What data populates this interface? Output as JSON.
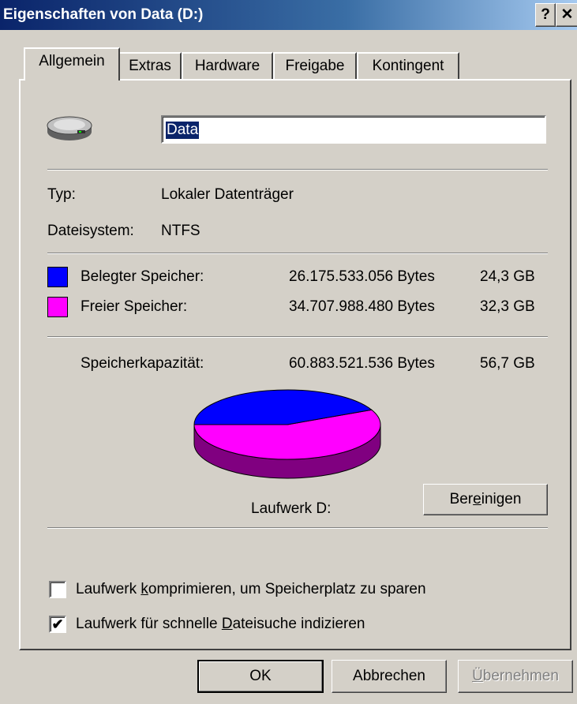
{
  "window": {
    "title": "Eigenschaften von Data (D:)",
    "help_label": "?",
    "close_label": "✕"
  },
  "tabs": [
    "Allgemein",
    "Extras",
    "Hardware",
    "Freigabe",
    "Kontingent"
  ],
  "active_tab": "Allgemein",
  "drive": {
    "icon": "hard-drive-icon",
    "name_value": "Data",
    "type_label": "Typ:",
    "type_value": "Lokaler Datenträger",
    "fs_label": "Dateisystem:",
    "fs_value": "NTFS"
  },
  "space": {
    "used": {
      "label": "Belegter Speicher:",
      "bytes": "26.175.533.056 Bytes",
      "size": "24,3 GB",
      "color": "#0000ff"
    },
    "free": {
      "label": "Freier Speicher:",
      "bytes": "34.707.988.480 Bytes",
      "size": "32,3 GB",
      "color": "#ff00ff"
    },
    "capacity": {
      "label": "Speicherkapazität:",
      "bytes": "60.883.521.536 Bytes",
      "size": "56,7 GB"
    }
  },
  "pie": {
    "used_fraction": 0.43,
    "used_color": "#0000ff",
    "free_color": "#ff00ff",
    "free_side_color": "#800080",
    "used_side_color": "#000080"
  },
  "drive_label": "Laufwerk D:",
  "cleanup": {
    "pre": "Ber",
    "ul": "e",
    "post": "inigen"
  },
  "options": {
    "compress": {
      "pre": "Laufwerk ",
      "ul": "k",
      "post": "omprimieren, um Speicherplatz zu sparen",
      "checked": false
    },
    "index": {
      "pre": "Laufwerk für schnelle ",
      "ul": "D",
      "post": "ateisuche indizieren",
      "checked": true
    }
  },
  "buttons": {
    "ok": "OK",
    "cancel": "Abbrechen",
    "apply": {
      "ul": "Ü",
      "post": "bernehmen",
      "enabled": false
    }
  }
}
